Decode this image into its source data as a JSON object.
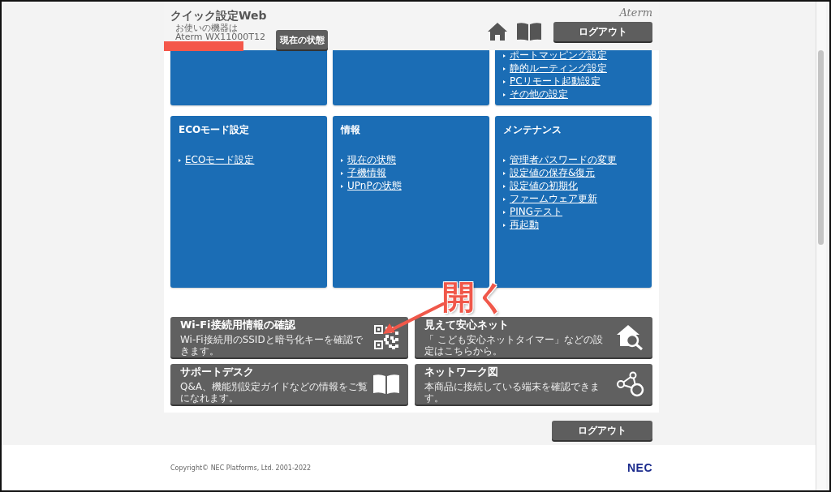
{
  "header": {
    "title": "クイック設定Web",
    "device_caption": "お使いの機器は",
    "device_model": "Aterm WX11000T12",
    "status_button": "現在の状態",
    "logout_button": "ログアウト",
    "brand": "Aterm"
  },
  "panels": [
    {
      "kind": "menu"
    },
    {
      "kind": "menu"
    },
    {
      "kind": "menu",
      "links": [
        "ポートマッピング設定",
        "静的ルーティング設定",
        "PCリモート起動設定",
        "その他の設定"
      ]
    },
    {
      "kind": "menu",
      "title": "ECOモード設定",
      "links": [
        "ECOモード設定"
      ]
    },
    {
      "kind": "menu",
      "title": "情報",
      "links": [
        "現在の状態",
        "子機情報",
        "UPnPの状態"
      ]
    },
    {
      "kind": "menu",
      "title": "メンテナンス",
      "links": [
        "管理者パスワードの変更",
        "設定値の保存&復元",
        "設定値の初期化",
        "ファームウェア更新",
        "PINGテスト",
        "再起動"
      ]
    }
  ],
  "annotation": {
    "text": "開く"
  },
  "tiles": [
    {
      "kind": "qr",
      "title": "Wi-Fi接続用情報の確認",
      "description": "Wi-Fi接続用のSSIDと暗号化キーを確認できます。"
    },
    {
      "kind": "house-search",
      "title": "見えて安心ネット",
      "description": "「 こども安心ネットタイマー」などの設定はこちらから。"
    },
    {
      "kind": "book",
      "title": "サポートデスク",
      "description": "Q&A、機能別設定ガイドなどの情報をご覧になれます。"
    },
    {
      "kind": "network",
      "title": "ネットワーク図",
      "description": "本商品に接続している端末を確認できます。"
    }
  ],
  "footer": {
    "logout_button": "ログアウト",
    "copyright": "Copyright© NEC Platforms, Ltd. 2001-2022",
    "logo": "NEC"
  }
}
